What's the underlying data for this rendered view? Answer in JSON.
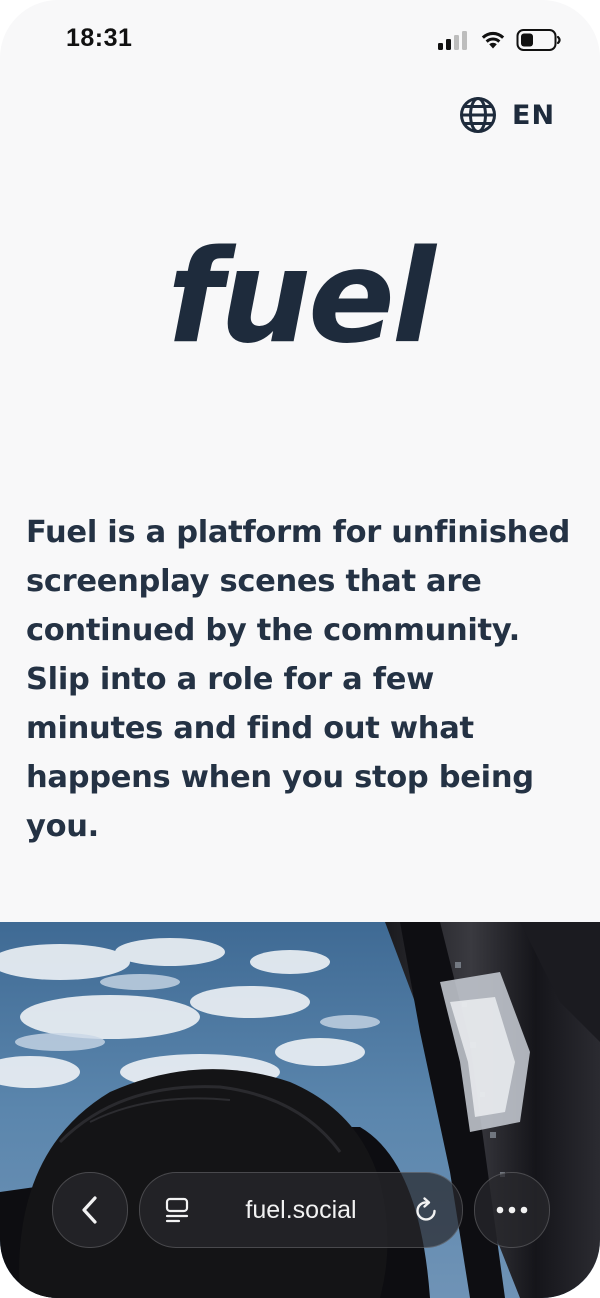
{
  "status_bar": {
    "time": "18:31",
    "icons": [
      "cellular-signal-icon",
      "wifi-icon",
      "battery-icon"
    ]
  },
  "language": {
    "icon": "globe-icon",
    "label": "EN"
  },
  "logo": {
    "text": "fuel"
  },
  "description": "Fuel is a platform for unfinished screenplay scenes that are continued by the community. Slip into a role for a few minutes and find out what happens when you stop being you.",
  "browser": {
    "url": "fuel.social",
    "icons": [
      "back-chevron-icon",
      "tabs-icon",
      "reload-icon",
      "more-icon"
    ]
  },
  "colors": {
    "text_dark": "#1e2b3c",
    "background": "#f8f8f9",
    "toolbar": "#28282c"
  }
}
